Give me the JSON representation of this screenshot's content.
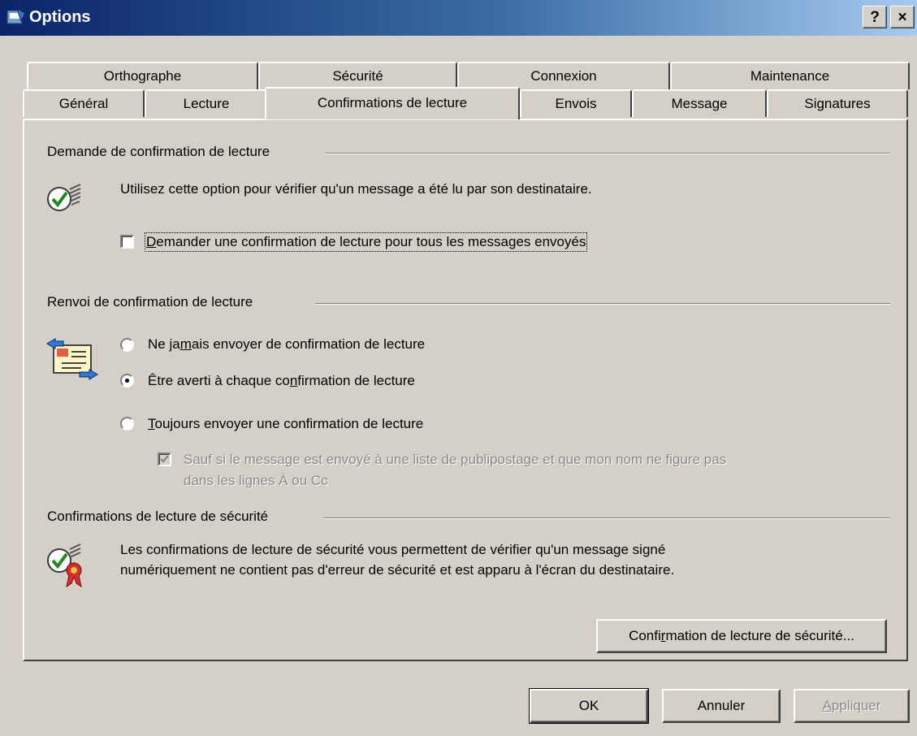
{
  "window": {
    "title": "Options",
    "help_label": "?",
    "close_label": "×"
  },
  "tabs_row1": [
    "Orthographe",
    "Sécurité",
    "Connexion",
    "Maintenance"
  ],
  "tabs_row2": [
    "Général",
    "Lecture",
    "Confirmations de lecture",
    "Envois",
    "Message",
    "Signatures"
  ],
  "selected_tab": "Confirmations de lecture",
  "request": {
    "title": "Demande de confirmation de lecture",
    "description": "Utilisez cette option pour vérifier qu'un message a été lu par son destinataire.",
    "checkbox_pre": "",
    "checkbox_key": "D",
    "checkbox_post": "emander une confirmation de lecture pour tous les messages envoyés",
    "checkbox_checked": false
  },
  "return": {
    "title": "Renvoi de confirmation de lecture",
    "never_pre": "Ne ja",
    "never_key": "m",
    "never_post": "ais envoyer de confirmation de lecture",
    "notify_pre": "Être averti à chaque co",
    "notify_key": "n",
    "notify_post": "firmation de lecture",
    "always_pre": "",
    "always_key": "T",
    "always_post": "oujours envoyer une confirmation de lecture",
    "selected": "notify",
    "exception_line1_pre": "Sauf si le message est envoyé à une liste de ",
    "exception_line1_key": "p",
    "exception_line1_post": "ublipostage et que mon nom ne figure pas",
    "exception_line2": "dans les lignes À ou Cc",
    "exception_checked": true
  },
  "secure": {
    "title": "Confirmations de lecture de sécurité",
    "description_line1": "Les confirmations de lecture de sécurité vous permettent de vérifier qu'un message signé",
    "description_line2": "numériquement ne contient pas d'erreur de sécurité et est apparu à l'écran du destinataire.",
    "button_pre": "Confi",
    "button_key": "r",
    "button_post": "mation de lecture de sécurité..."
  },
  "buttons": {
    "ok": "OK",
    "cancel": "Annuler",
    "apply_key": "A",
    "apply_post": "ppliquer"
  },
  "icons": {
    "read_receipt": "read-receipt-check-icon",
    "return_receipt": "envelope-arrows-icon",
    "secure_receipt": "secure-receipt-seal-icon"
  }
}
